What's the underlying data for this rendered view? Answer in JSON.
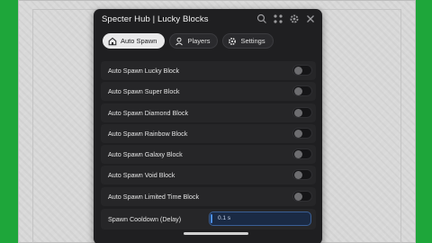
{
  "window": {
    "title": "Specter Hub | Lucky Blocks"
  },
  "title_icons": [
    "search-icon",
    "move-icon",
    "settings-icon",
    "close-icon"
  ],
  "tabs": [
    {
      "label": "Auto Spawn",
      "icon": "home-icon",
      "active": true
    },
    {
      "label": "Players",
      "icon": "user-icon",
      "active": false
    },
    {
      "label": "Settings",
      "icon": "gear-icon",
      "active": false
    }
  ],
  "toggles": [
    {
      "label": "Auto Spawn Lucky Block",
      "on": false
    },
    {
      "label": "Auto Spawn Super Block",
      "on": false
    },
    {
      "label": "Auto Spawn Diamond Block",
      "on": false
    },
    {
      "label": "Auto Spawn Rainbow Block",
      "on": false
    },
    {
      "label": "Auto Spawn Galaxy Block",
      "on": false
    },
    {
      "label": "Auto Spawn Void Block",
      "on": false
    },
    {
      "label": "Auto Spawn Limited Time Block",
      "on": false
    }
  ],
  "cooldown": {
    "label": "Spawn Cooldown (Delay)",
    "value": "0.1 s"
  },
  "colors": {
    "window_bg": "#1f1f21",
    "row_bg": "#262628",
    "accent": "#4c8ff0",
    "grass": "#1ea63a"
  }
}
